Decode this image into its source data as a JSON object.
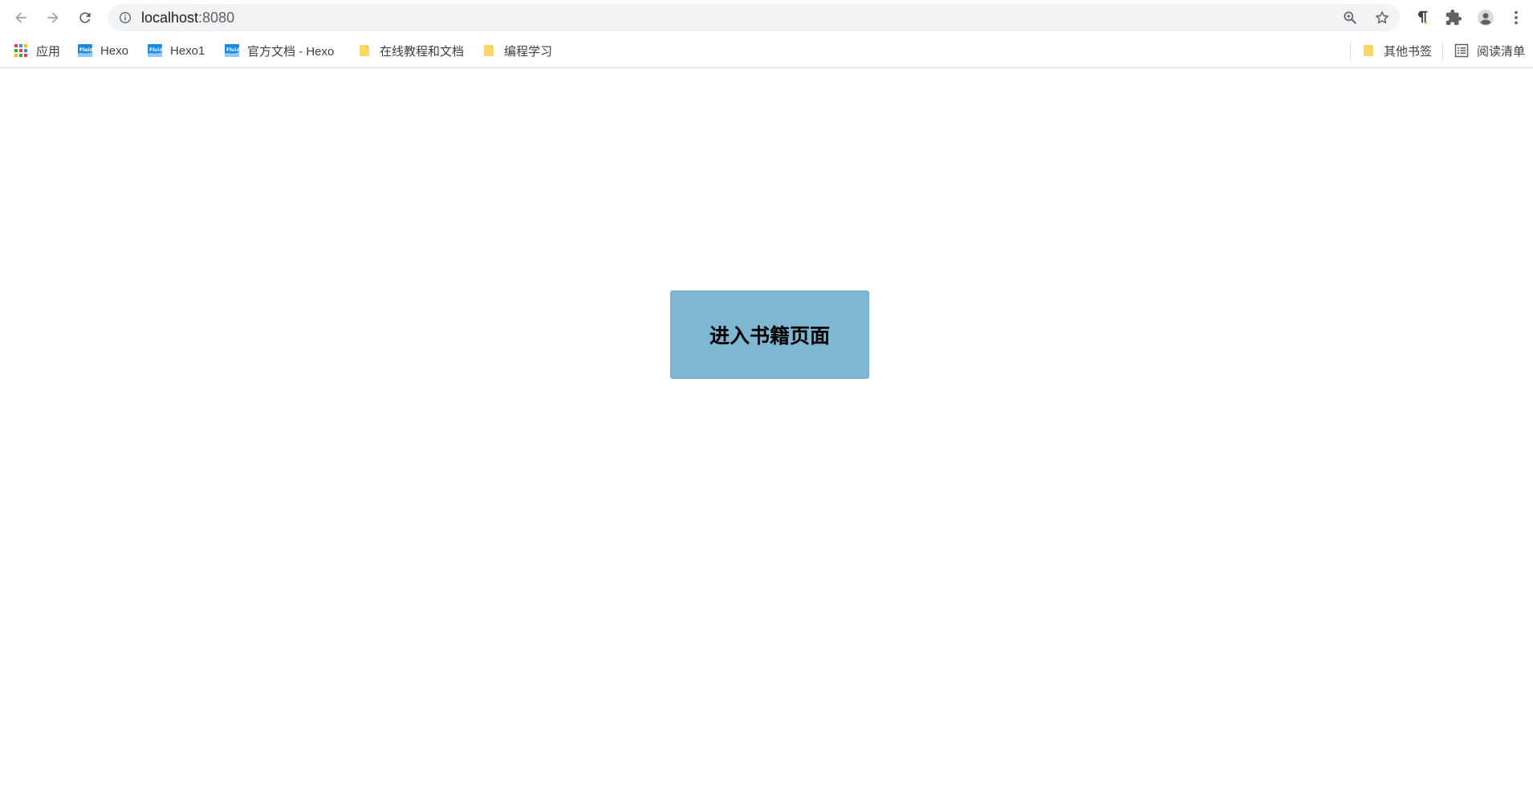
{
  "browser": {
    "address_bar": {
      "url_host": "localhost",
      "url_port": ":8080"
    },
    "icons": {
      "back": "arrow-left-icon",
      "forward": "arrow-right-icon",
      "reload": "reload-icon",
      "site_info": "info-circle-icon",
      "zoom": "zoom-icon",
      "bookmark_star": "star-icon",
      "extension_1": "pilcrow-extension-icon",
      "extensions": "puzzle-icon",
      "profile": "avatar-icon",
      "menu": "kebab-menu-icon"
    }
  },
  "bookmarks_bar": {
    "apps_label": "应用",
    "items": [
      {
        "label": "Hexo",
        "icon": "fluid-favicon"
      },
      {
        "label": "Hexo1",
        "icon": "fluid-favicon"
      },
      {
        "label": "官方文档 - Hexo",
        "icon": "fluid-favicon"
      },
      {
        "label": "在线教程和文档",
        "icon": "folder-icon"
      },
      {
        "label": "编程学习",
        "icon": "folder-icon"
      }
    ],
    "other_bookmarks_label": "其他书签",
    "reading_list_label": "阅读清单"
  },
  "page": {
    "enter_button_label": "进入书籍页面",
    "button_color": "#7fb6d1"
  }
}
